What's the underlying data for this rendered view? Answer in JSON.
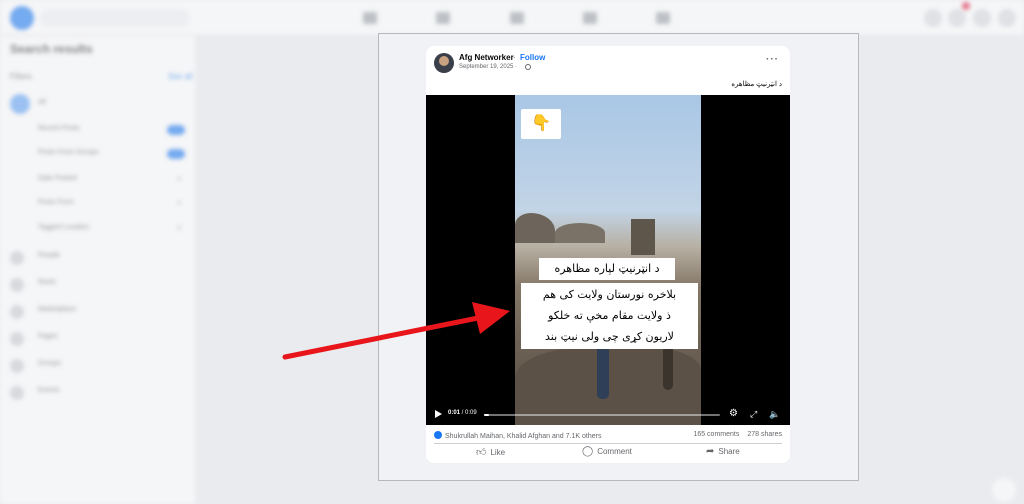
{
  "sidebar": {
    "title": "Search results",
    "filters_label": "Filters",
    "see_all": "See all",
    "items": [
      {
        "label": "All"
      },
      {
        "label": "Recent Posts"
      },
      {
        "label": "Posts From Groups"
      },
      {
        "label": "Date Posted"
      },
      {
        "label": "Posts From"
      },
      {
        "label": "Tagged Location"
      },
      {
        "label": "People"
      },
      {
        "label": "Reels"
      },
      {
        "label": "Marketplace"
      },
      {
        "label": "Pages"
      },
      {
        "label": "Groups"
      },
      {
        "label": "Events"
      }
    ]
  },
  "post": {
    "author": "Afg Networker",
    "separator": "·",
    "follow": "Follow",
    "date": "September 19, 2025 ·",
    "more": "···",
    "caption": "د انټرنیټ مظاهره",
    "video": {
      "emoji": "👇",
      "subtitle_line1": "د انټرنیټ لپاره مظاهره",
      "subtitle_lines": [
        "بلاخره نورستان ولایت کی هم",
        "ذ ولایت مقام مخې ته خلکو",
        "لاریون کړی چی ولی نیټ بند"
      ],
      "time_current": "0:01",
      "time_total": "0:09",
      "progress": 0.02
    },
    "reactions_text": "Shukrullah Maihan, Khalid Afghan and 7.1K others",
    "comments": "165 comments",
    "shares": "278 shares",
    "actions": {
      "like": "Like",
      "comment": "Comment",
      "share": "Share"
    }
  },
  "colors": {
    "accent": "#1877f2",
    "arrow": "#e8161b"
  }
}
